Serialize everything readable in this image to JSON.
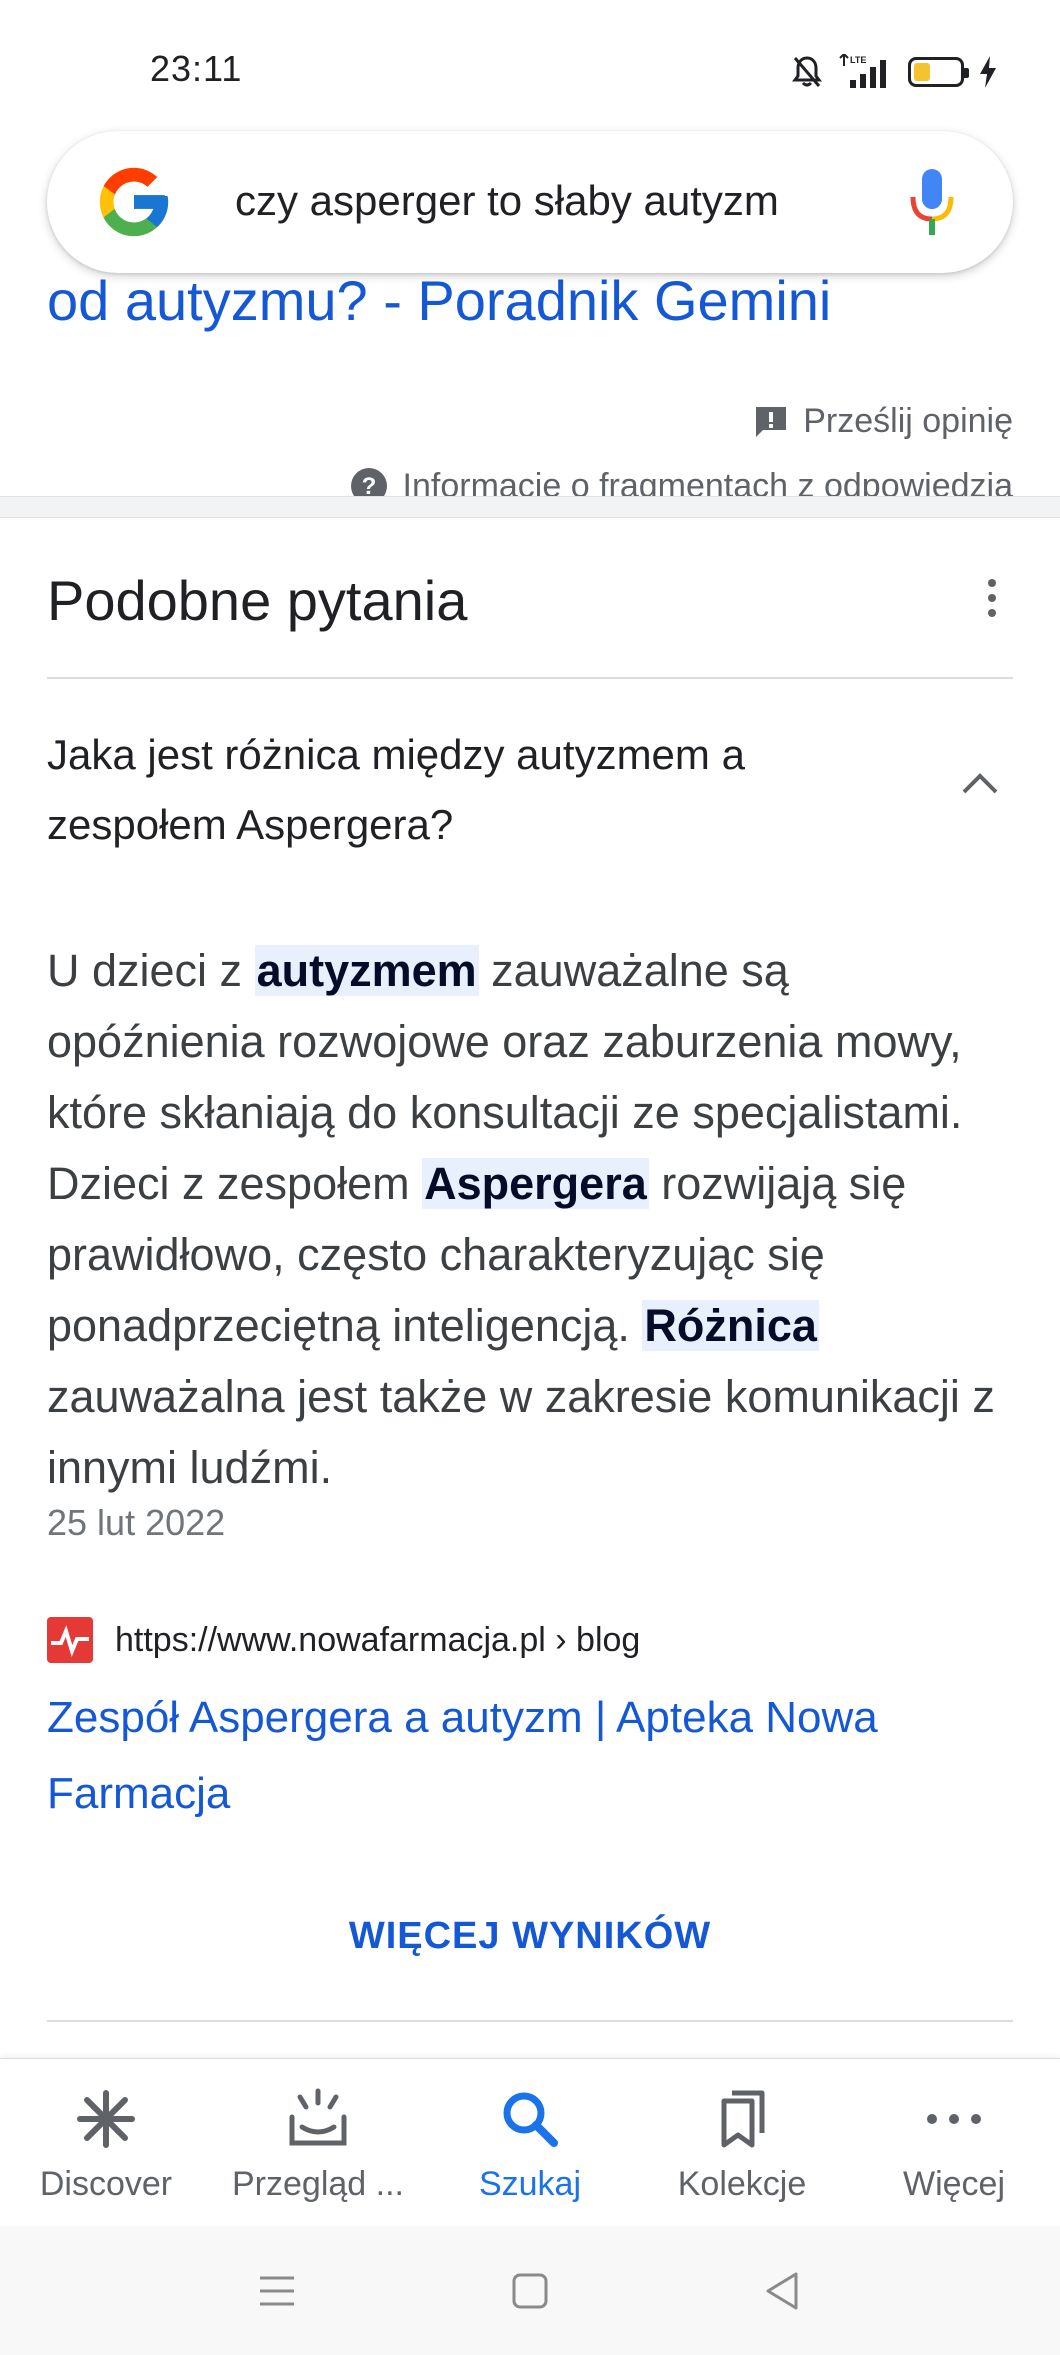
{
  "status_bar": {
    "time": "23:11",
    "icons": [
      "bell-off-icon",
      "lte-signal-icon",
      "battery-icon",
      "charging-icon"
    ]
  },
  "search": {
    "query": "czy asperger to słaby autyzm",
    "icons": [
      "google-logo",
      "mic-icon"
    ]
  },
  "previous_result": {
    "title_fragment": "od autyzmu? - Poradnik Gemini",
    "feedback_label": "Prześlij opinię",
    "snippet_info_label": "Informacje o fragmentach z odpowiedzią"
  },
  "related_questions": {
    "title": "Podobne pytania",
    "question": "Jaka jest różnica między autyzmem a zespołem Aspergera?",
    "answer": {
      "p1": "U dzieci z ",
      "h1": "autyzmem",
      "p2": " zauważalne są opóźnienia rozwojowe oraz zaburzenia mowy, które skłaniają do konsultacji ze specjalistami. Dzieci z zespołem ",
      "h2": "Aspergera",
      "p3": " rozwijają się prawidłowo, często charakteryzując się ponadprzeciętną inteligencją. ",
      "h3": "Różnica",
      "p4": " zauważalna jest także w zakresie komunikacji z innymi ludźmi."
    },
    "date": "25 lut 2022",
    "source": {
      "url": "https://www.nowafarmacja.pl › blog",
      "title": "Zespół Aspergera a autyzm | Apteka Nowa Farmacja"
    },
    "more_results_label": "WIĘCEJ WYNIKÓW"
  },
  "bottom_nav": {
    "items": [
      {
        "label": "Discover",
        "icon": "asterisk-icon"
      },
      {
        "label": "Przegląd ...",
        "icon": "snapshot-icon"
      },
      {
        "label": "Szukaj",
        "icon": "search-icon",
        "active": true
      },
      {
        "label": "Kolekcje",
        "icon": "bookmarks-icon"
      },
      {
        "label": "Więcej",
        "icon": "more-dots-icon"
      }
    ]
  },
  "system_nav": [
    "menu-icon",
    "home-icon",
    "back-icon"
  ],
  "colors": {
    "link": "#1558d6",
    "active": "#1a73e8",
    "highlight_bg": "#e8f0fe",
    "text": "#202124",
    "muted": "#5f6368"
  }
}
